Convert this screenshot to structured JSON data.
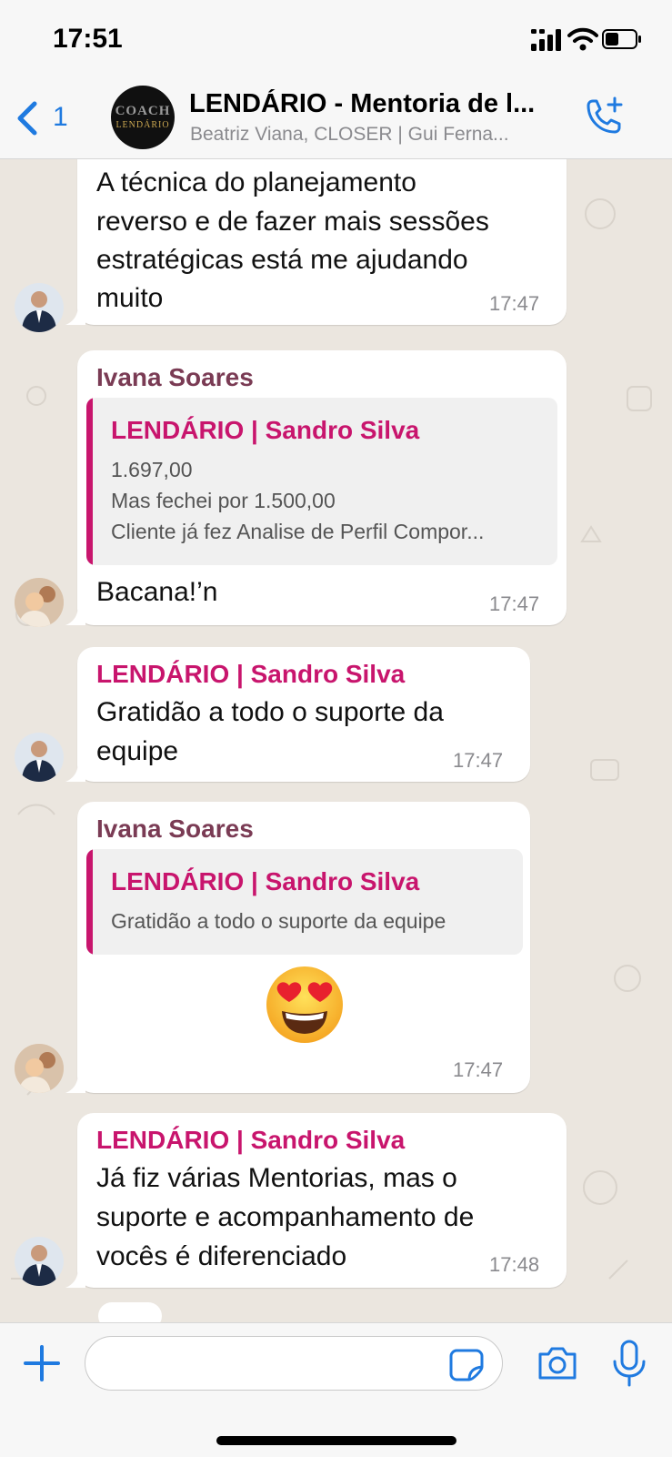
{
  "status_bar": {
    "time": "17:51"
  },
  "header": {
    "back_count": "1",
    "group_avatar_text": "COACH",
    "group_avatar_subtext": "LENDÁRIO",
    "title": "LENDÁRIO - Mentoria de l...",
    "subtitle": "Beatriz Viana, CLOSER | Gui Ferna..."
  },
  "messages": [
    {
      "text": "A técnica do planejamento reverso e de fazer mais sessões estratégicas está me ajudando muito",
      "lines": [
        "A técnica do planejamento",
        "reverso e de fazer mais sessões",
        "estratégicas está me ajudando",
        "muito"
      ],
      "time": "17:47"
    },
    {
      "sender": "Ivana  Soares",
      "quote": {
        "sender": "LENDÁRIO | Sandro Silva",
        "lines": [
          "1.697,00",
          "Mas fechei por 1.500,00",
          "Cliente já fez Analise de Perfil Compor..."
        ]
      },
      "text": "Bacana!’n",
      "time": "17:47"
    },
    {
      "sender": "LENDÁRIO | Sandro Silva",
      "lines": [
        "Gratidão a todo o suporte da",
        "equipe"
      ],
      "time": "17:47"
    },
    {
      "sender": "Ivana  Soares",
      "quote": {
        "sender": "LENDÁRIO | Sandro Silva",
        "lines": [
          "Gratidão a todo o suporte da equipe"
        ]
      },
      "emoji": "smiling-face-with-heart-eyes",
      "time": "17:47"
    },
    {
      "sender": "LENDÁRIO | Sandro Silva",
      "lines": [
        "Já fiz várias Mentorias, mas o",
        "suporte e acompanhamento de",
        "vocês é diferenciado"
      ],
      "time": "17:48"
    }
  ],
  "colors": {
    "accent": "#1f7ae0",
    "sender_sandro": "#c8156d",
    "sender_ivana": "#7a3b54",
    "chat_bg": "#ebe6df"
  }
}
